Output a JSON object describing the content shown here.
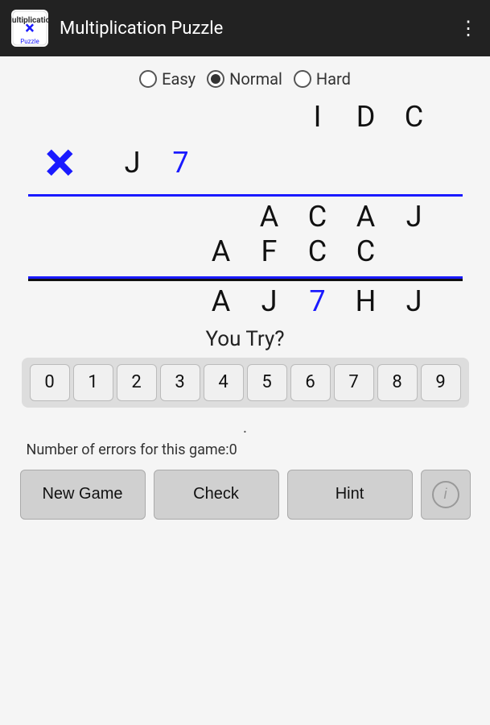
{
  "app": {
    "title": "Multiplication Puzzle",
    "logo_text": "×"
  },
  "menu": {
    "icon": "⋮"
  },
  "difficulty": {
    "options": [
      "Easy",
      "Normal",
      "Hard"
    ],
    "selected": "Normal"
  },
  "puzzle": {
    "multiplicand": [
      "I",
      "D",
      "C"
    ],
    "multiplier_row2_letters": [
      "J",
      ""
    ],
    "multiplier_row2_number": "7",
    "big_x": "×",
    "partial1": [
      "A",
      "C",
      "A",
      "J"
    ],
    "partial2": [
      "A",
      "F",
      "C",
      "C"
    ],
    "result": [
      "A",
      "J",
      "",
      "H",
      "J"
    ],
    "result_highlighted_index": 2,
    "result_highlighted_value": "7"
  },
  "you_try_label": "You Try?",
  "number_pad": [
    "0",
    "1",
    "2",
    "3",
    "4",
    "5",
    "6",
    "7",
    "8",
    "9"
  ],
  "dot": ".",
  "errors_label": "Number of errors for this game:",
  "errors_count": "0",
  "buttons": {
    "new_game": "New Game",
    "check": "Check",
    "hint": "Hint",
    "info_icon": "i"
  },
  "colors": {
    "blue": "#1a1aff",
    "dark": "#111",
    "accent_bar": "#1a1aff"
  }
}
